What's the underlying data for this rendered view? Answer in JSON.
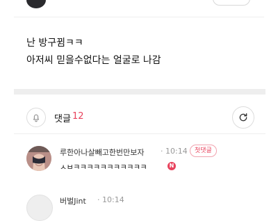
{
  "post": {
    "lines": [
      "난 방구뀜ㅋㅋ",
      "아저씨 믿을수없다는 얼굴로 나감"
    ]
  },
  "comments": {
    "title": "댓글",
    "count": "12",
    "items": [
      {
        "author": "루한아나살빼고한번만보자",
        "time": "· 10:14",
        "badge": "첫댓글",
        "text": "ㅅㅂㅋㅋㅋㅋㅋㅋㅋㅋㅋㅋㅋ",
        "new_badge": "N"
      },
      {
        "author": "버벌Jint",
        "time": "· 10:14"
      }
    ]
  },
  "icons": {
    "notify": "bell-icon",
    "refresh": "refresh-icon"
  },
  "colors": {
    "accent": "#e8425c",
    "divider": "#eeeeee"
  }
}
